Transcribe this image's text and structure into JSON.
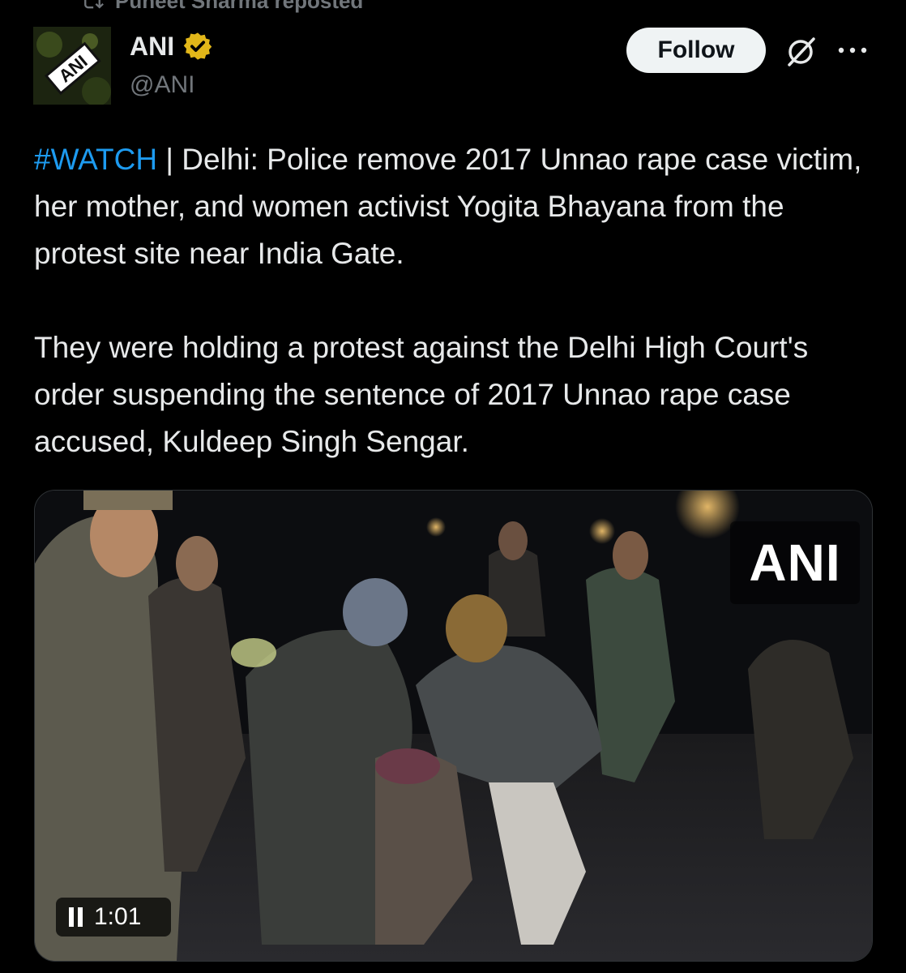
{
  "repost": {
    "text": "Puneet Sharma reposted",
    "icon": "repost-icon"
  },
  "author": {
    "avatar_text": "ANI",
    "name": "ANI",
    "handle": "@ANI",
    "verified_icon": "verified-gold-badge-icon",
    "verified_color": "#e2b719"
  },
  "actions": {
    "follow_label": "Follow",
    "grok_icon": "grok-icon",
    "more_icon": "more-icon"
  },
  "tweet": {
    "hashtag": "#WATCH",
    "p1_rest": " | Delhi: Police remove 2017 Unnao rape case victim, her mother, and women activist Yogita Bhayana from the protest site near India Gate.",
    "p2": "They were holding a protest against the Delhi High Court's order suspending the sentence of 2017 Unnao rape case accused, Kuldeep Singh Sengar."
  },
  "media": {
    "watermark": "ANI",
    "time": "1:01",
    "pause_icon": "pause-icon"
  },
  "colors": {
    "background": "#000000",
    "text": "#e7e9ea",
    "secondary": "#71767b",
    "link": "#1d9bf0",
    "follow_bg": "#eff3f4"
  }
}
